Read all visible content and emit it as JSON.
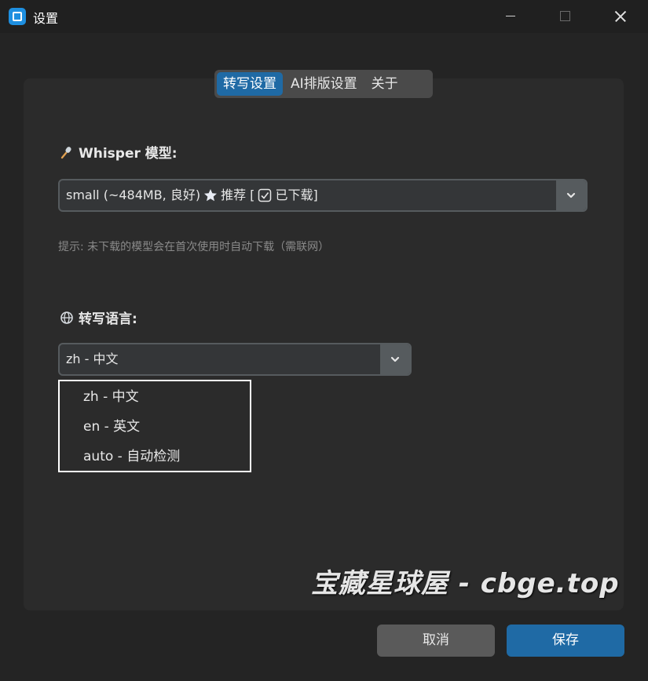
{
  "window": {
    "title": "设置"
  },
  "tabs": [
    {
      "label": "转写设置",
      "active": true
    },
    {
      "label": "AI排版设置",
      "active": false
    },
    {
      "label": "关于",
      "active": false
    }
  ],
  "model": {
    "label": "Whisper 模型:",
    "icon": "microphone-icon",
    "selected_prefix": "small (~484MB, 良好)",
    "selected_star_icon": "star-icon",
    "selected_recommend": "推荐 [",
    "selected_check_icon": "check-box-icon",
    "selected_suffix": "已下载]",
    "hint": "提示: 未下载的模型会在首次使用时自动下载（需联网）"
  },
  "language": {
    "label": "转写语言:",
    "icon": "globe-icon",
    "selected": "zh - 中文",
    "options": [
      "zh - 中文",
      "en - 英文",
      "auto - 自动检测"
    ]
  },
  "watermark": "宝藏星球屋 - cbge.top",
  "buttons": {
    "cancel": "取消",
    "save": "保存"
  },
  "colors": {
    "accent": "#1f6aa5",
    "background": "#242424",
    "panel": "#2b2b2b",
    "cancel_button": "#5a5a5a"
  }
}
